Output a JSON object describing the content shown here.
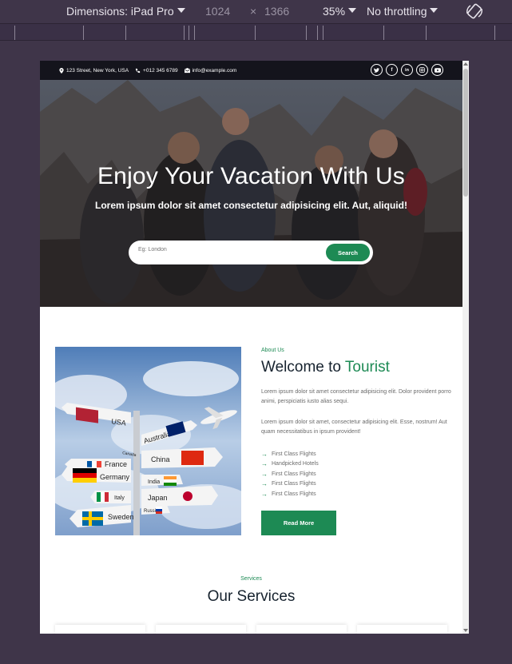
{
  "devtools": {
    "device_label": "Dimensions: iPad Pro",
    "width": "1024",
    "times": "×",
    "height": "1366",
    "zoom": "35%",
    "throttling": "No throttling"
  },
  "topbar": {
    "address": "123 Street, New York, USA",
    "phone": "+012 345 6789",
    "email": "info@example.com",
    "socials": [
      "twitter-icon",
      "facebook-icon",
      "linkedin-icon",
      "instagram-icon",
      "youtube-icon"
    ]
  },
  "hero": {
    "title": "Enjoy Your Vacation With Us",
    "subtitle": "Lorem ipsum dolor sit amet consectetur adipisicing elit. Aut, aliquid!",
    "search_placeholder": "Eg: London",
    "search_button": "Search"
  },
  "about": {
    "label": "About Us",
    "title_main": "Welcome to ",
    "title_accent": "Tourist",
    "para1": "Lorem ipsum dolor sit amet consectetur adipisicing elit. Dolor provident porro animi, perspiciatis iusto alias sequi.",
    "para2": "Lorem ipsum dolor sit amet, consectetur adipisicing elit. Esse, nostrum! Aut quam necessitatibus in ipsum provident!",
    "features": [
      "First Class Flights",
      "Handpicked Hotels",
      "First Class Flights",
      "First Class Flights",
      "First Class Flights"
    ],
    "button": "Read More",
    "signs": [
      "USA",
      "Canada",
      "Australia",
      "France",
      "China",
      "Germany",
      "India",
      "Italy",
      "Japan",
      "Sweden",
      "Russia"
    ]
  },
  "services": {
    "label": "Services",
    "title": "Our Services"
  },
  "colors": {
    "accent": "#1d8a54",
    "topbar": "#14141c",
    "devtools_bg": "#3f3549"
  }
}
